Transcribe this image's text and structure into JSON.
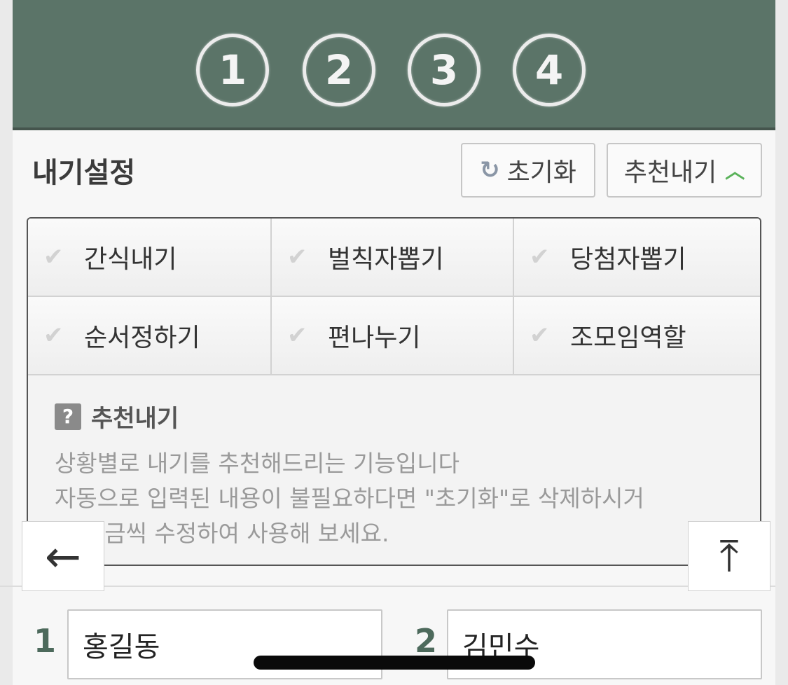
{
  "steps": [
    "1",
    "2",
    "3",
    "4"
  ],
  "settings": {
    "title": "내기설정",
    "reset_icon": "refresh-icon",
    "reset_label": "초기화",
    "recommend_label": "추천내기",
    "recommend_chevron": "chevron-up-icon"
  },
  "options": [
    {
      "label": "간식내기"
    },
    {
      "label": "벌칙자뽑기"
    },
    {
      "label": "당첨자뽑기"
    },
    {
      "label": "순서정하기"
    },
    {
      "label": "편나누기"
    },
    {
      "label": "조모임역할"
    }
  ],
  "info": {
    "icon": "?",
    "title": "추천내기",
    "lines": [
      "상황별로 내기를 추천해드리는 기능입니다",
      "자동으로 입력된 내용이 불필요하다면 \"초기화\"로 삭제하시거",
      "나 조금씩 수정하여 사용해 보세요."
    ]
  },
  "nav": {
    "back_icon": "←",
    "top_icon": "⤒"
  },
  "players": [
    {
      "number": "1",
      "name": "홍길동"
    },
    {
      "number": "2",
      "name": "김민수"
    }
  ],
  "colors": {
    "board": "#5b7468",
    "accent_green": "#5ab25a",
    "number_green": "#4d6a5c"
  }
}
